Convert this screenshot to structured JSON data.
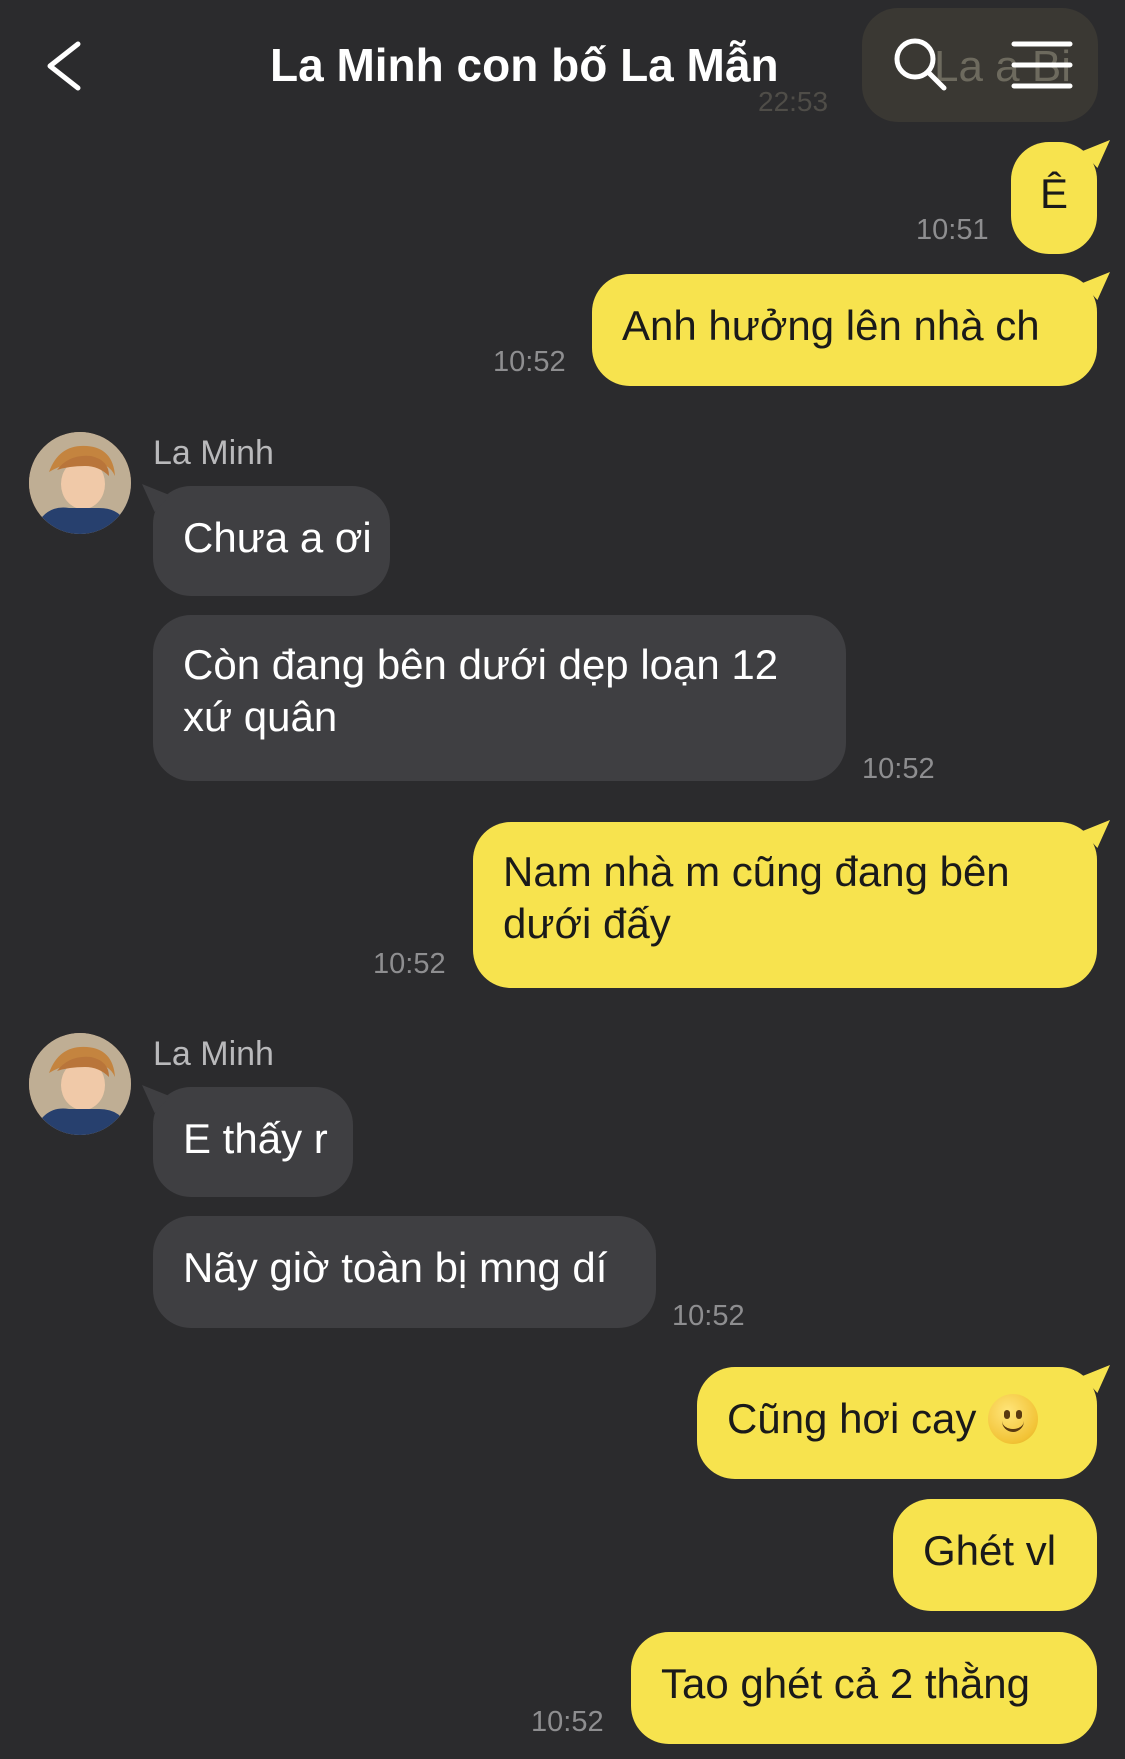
{
  "header": {
    "title": "La Minh con bố La Mẫn",
    "preview_text": "La a Bi",
    "preview_time": "22:53",
    "back_icon": "chevron-left-icon",
    "search_icon": "search-icon",
    "menu_icon": "hamburger-menu-icon"
  },
  "colors": {
    "background": "#2b2b2d",
    "sent_bubble": "#f7e34e",
    "received_bubble": "#3f3f42",
    "timestamp": "#8e8e90"
  },
  "messages": [
    {
      "direction": "sent",
      "text": "Ê",
      "time": "10:51"
    },
    {
      "direction": "sent",
      "text": "Anh hưởng lên nhà ch",
      "time": "10:52"
    },
    {
      "direction": "received",
      "sender": "La Minh",
      "text": "Chưa a ơi"
    },
    {
      "direction": "received",
      "text": "Còn đang bên dưới dẹp loạn 12 xứ quân",
      "time": "10:52"
    },
    {
      "direction": "sent",
      "text": "Nam nhà m cũng đang bên dưới đấy",
      "time": "10:52"
    },
    {
      "direction": "received",
      "sender": "La Minh",
      "text": "E thấy r"
    },
    {
      "direction": "received",
      "text": "Nãy giờ toàn bị mng dí",
      "time": "10:52"
    },
    {
      "direction": "sent",
      "text": "Cũng hơi cay",
      "emoji": "slightly-smiling-face-icon"
    },
    {
      "direction": "sent",
      "text": "Ghét vl"
    },
    {
      "direction": "sent",
      "text": "Tao ghét cả 2 thằng",
      "time": "10:52"
    }
  ]
}
